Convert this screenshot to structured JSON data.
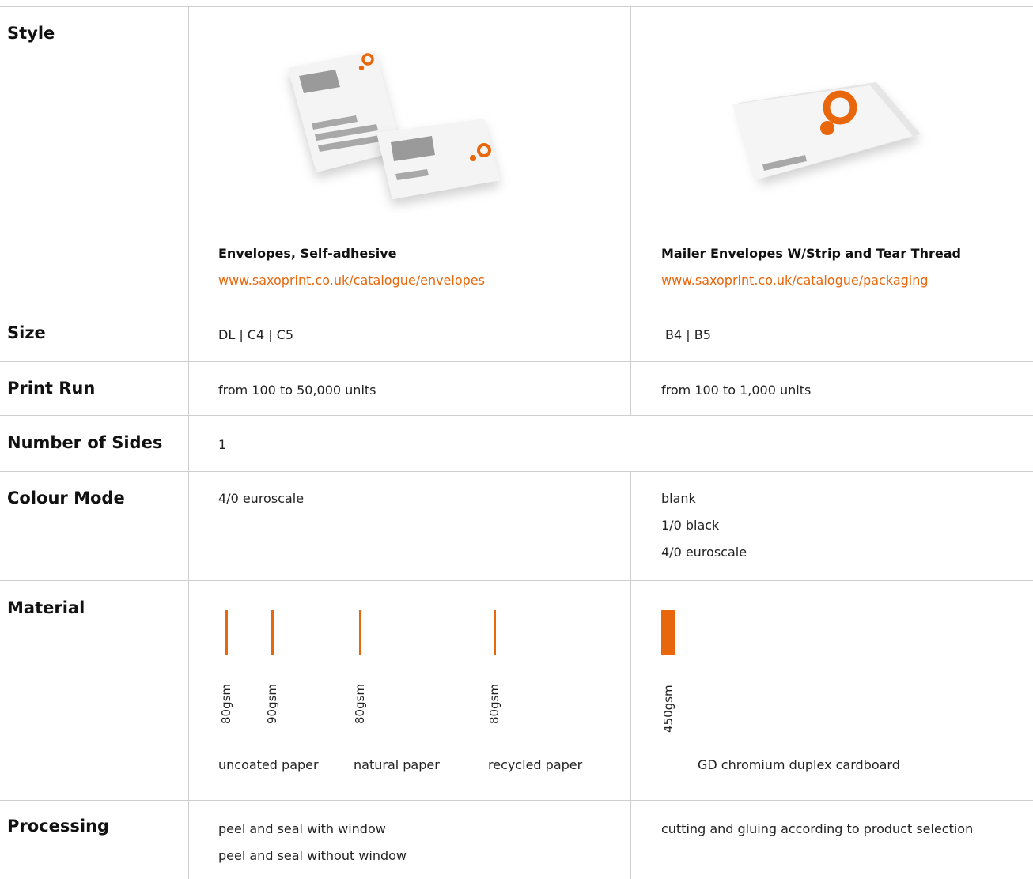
{
  "rows": {
    "style": "Style",
    "size": "Size",
    "print_run": "Print Run",
    "number_of_sides": "Number of Sides",
    "colour_mode": "Colour Mode",
    "material": "Material",
    "processing": "Processing"
  },
  "products": [
    {
      "title": "Envelopes, Self-adhesive",
      "link": "www.saxoprint.co.uk/catalogue/envelopes",
      "size": "DL | C4 | C5",
      "print_run": "from 100 to 50,000 units",
      "sides": "1",
      "colour_modes": [
        "4/0 euroscale"
      ],
      "materials": [
        {
          "gsm": "80gsm",
          "value": 80
        },
        {
          "gsm": "90gsm",
          "value": 90
        },
        {
          "gsm": "80gsm",
          "value": 80
        },
        {
          "gsm": "80gsm",
          "value": 80
        }
      ],
      "material_names": [
        "uncoated paper",
        "natural paper",
        "recycled paper"
      ],
      "processing": [
        "peel and seal with window",
        "peel and seal without window"
      ]
    },
    {
      "title": "Mailer Envelopes W/Strip and Tear Thread",
      "link": "www.saxoprint.co.uk/catalogue/packaging",
      "size": "B4 | B5",
      "print_run": "from 100 to 1,000 units",
      "colour_modes": [
        "blank",
        "1/0 black",
        "4/0 euroscale"
      ],
      "materials": [
        {
          "gsm": "450gsm",
          "value": 450
        }
      ],
      "material_names": [
        "GD chromium duplex cardboard"
      ],
      "processing": [
        "cutting and gluing according to product selection"
      ]
    }
  ],
  "colors": {
    "accent": "#e8670c",
    "grid": "#cfcfcf"
  },
  "icons": [
    "envelope-pair-image",
    "mailer-envelope-image",
    "saxoprint-logo-icon"
  ]
}
